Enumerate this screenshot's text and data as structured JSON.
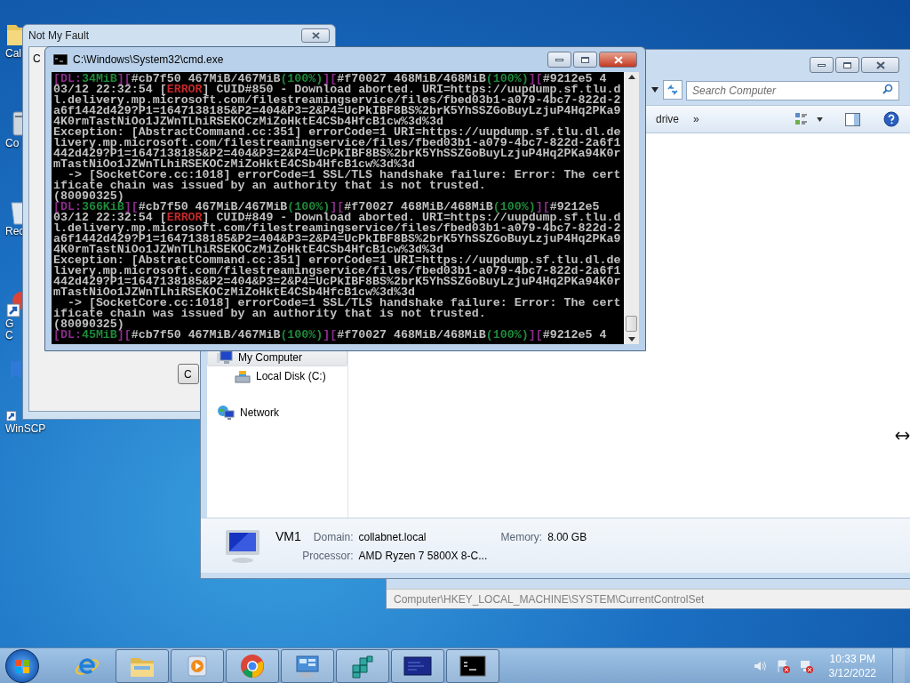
{
  "desktop_icons": [
    {
      "kind": "folder",
      "label_lines": [
        "Cal"
      ]
    },
    {
      "kind": "drive",
      "label_lines": [
        "Co"
      ]
    },
    {
      "kind": "recycle",
      "label_lines": [
        "Rec"
      ]
    },
    {
      "kind": "chrome-shortcut",
      "label_lines": [
        "G",
        "C"
      ]
    },
    {
      "kind": "bookmark"
    },
    {
      "kind": "winscp",
      "label_lines": [
        "WinSCP"
      ]
    }
  ],
  "back_window": {
    "title": "Not My Fault",
    "panel_text": "C",
    "button": "C"
  },
  "registry_window": {
    "status": "Computer\\HKEY_LOCAL_MACHINE\\SYSTEM\\CurrentControlSet"
  },
  "explorer": {
    "search": {
      "placeholder": "Search Computer"
    },
    "toolbar": {
      "command": "drive",
      "more": "»"
    },
    "nav": [
      {
        "label": "My Computer",
        "kind": "computer",
        "selected": true,
        "children": [
          {
            "label": "Local Disk (C:)",
            "kind": "disk",
            "selected": false
          }
        ]
      },
      {
        "label": "Network",
        "kind": "network",
        "selected": false
      }
    ],
    "details": {
      "name": "VM1",
      "domain_label": "Domain:",
      "domain": "collabnet.local",
      "memory_label": "Memory:",
      "memory": "8.00 GB",
      "processor_label": "Processor:",
      "processor": "AMD Ryzen 7 5800X 8-C..."
    }
  },
  "console": {
    "title": "C:\\Windows\\System32\\cmd.exe",
    "lines": [
      [
        {
          "text": "[DL:",
          "color": "#8b2c8b"
        },
        {
          "text": "34MiB",
          "color": "#1e8a3a"
        },
        {
          "text": "][",
          "color": "#8b2c8b"
        },
        {
          "text": "#cb7f50 467MiB/467MiB",
          "color": "#c0c0c0"
        },
        {
          "text": "(100%)",
          "color": "#1e8a3a"
        },
        {
          "text": "][",
          "color": "#8b2c8b"
        },
        {
          "text": "#f70027 468MiB/468MiB",
          "color": "#c0c0c0"
        },
        {
          "text": "(100%)",
          "color": "#1e8a3a"
        },
        {
          "text": "][",
          "color": "#8b2c8b"
        },
        {
          "text": "#9212e5 4",
          "color": "#c0c0c0"
        }
      ],
      [
        {
          "text": "03/12 22:32:54 [",
          "color": "#c0c0c0"
        },
        {
          "text": "ERROR",
          "color": "#c62828"
        },
        {
          "text": "] CUID#850 - Download aborted. URI=https://uupdump.sf.tlu.d",
          "color": "#c0c0c0"
        }
      ],
      [
        {
          "text": "l.delivery.mp.microsoft.com/filestreamingservice/files/fbed03b1-a079-4bc7-822d-2",
          "color": "#c0c0c0"
        }
      ],
      [
        {
          "text": "a6f1442d429?P1=1647138185&P2=404&P3=2&P4=UcPkIBF8BS%2brK5YhSSZGoBuyLzjuP4Hq2PKa9",
          "color": "#c0c0c0"
        }
      ],
      [
        {
          "text": "4K0rmTastNiOo1JZWnTLhiRSEKOCzMiZoHktE4CSb4HfcB1cw%3d%3d",
          "color": "#c0c0c0"
        }
      ],
      [
        {
          "text": "Exception: [AbstractCommand.cc:351] errorCode=1 URI=https://uupdump.sf.tlu.dl.de",
          "color": "#c0c0c0"
        }
      ],
      [
        {
          "text": "livery.mp.microsoft.com/filestreamingservice/files/fbed03b1-a079-4bc7-822d-2a6f1",
          "color": "#c0c0c0"
        }
      ],
      [
        {
          "text": "442d429?P1=1647138185&P2=404&P3=2&P4=UcPkIBF8BS%2brK5YhSSZGoBuyLzjuP4Hq2PKa94K0r",
          "color": "#c0c0c0"
        }
      ],
      [
        {
          "text": "mTastNiOo1JZWnTLhiRSEKOCzMiZoHktE4CSb4HfcB1cw%3d%3d",
          "color": "#c0c0c0"
        }
      ],
      [
        {
          "text": "  -> [SocketCore.cc:1018] errorCode=1 SSL/TLS handshake failure: Error: The cert",
          "color": "#c0c0c0"
        }
      ],
      [
        {
          "text": "ificate chain was issued by an authority that is not trusted.",
          "color": "#c0c0c0"
        }
      ],
      [
        {
          "text": "(80090325)",
          "color": "#c0c0c0"
        }
      ],
      [
        {
          "text": "[DL:",
          "color": "#8b2c8b"
        },
        {
          "text": "366KiB",
          "color": "#1e8a3a"
        },
        {
          "text": "][",
          "color": "#8b2c8b"
        },
        {
          "text": "#cb7f50 467MiB/467MiB",
          "color": "#c0c0c0"
        },
        {
          "text": "(100%)",
          "color": "#1e8a3a"
        },
        {
          "text": "][",
          "color": "#8b2c8b"
        },
        {
          "text": "#f70027 468MiB/468MiB",
          "color": "#c0c0c0"
        },
        {
          "text": "(100%)",
          "color": "#1e8a3a"
        },
        {
          "text": "][",
          "color": "#8b2c8b"
        },
        {
          "text": "#9212e5",
          "color": "#c0c0c0"
        }
      ],
      [
        {
          "text": "03/12 22:32:54 [",
          "color": "#c0c0c0"
        },
        {
          "text": "ERROR",
          "color": "#c62828"
        },
        {
          "text": "] CUID#849 - Download aborted. URI=https://uupdump.sf.tlu.d",
          "color": "#c0c0c0"
        }
      ],
      [
        {
          "text": "l.delivery.mp.microsoft.com/filestreamingservice/files/fbed03b1-a079-4bc7-822d-2",
          "color": "#c0c0c0"
        }
      ],
      [
        {
          "text": "a6f1442d429?P1=1647138185&P2=404&P3=2&P4=UcPkIBF8BS%2brK5YhSSZGoBuyLzjuP4Hq2PKa9",
          "color": "#c0c0c0"
        }
      ],
      [
        {
          "text": "4K0rmTastNiOo1JZWnTLhiRSEKOCzMiZoHktE4CSb4HfcB1cw%3d%3d",
          "color": "#c0c0c0"
        }
      ],
      [
        {
          "text": "Exception: [AbstractCommand.cc:351] errorCode=1 URI=https://uupdump.sf.tlu.dl.de",
          "color": "#c0c0c0"
        }
      ],
      [
        {
          "text": "livery.mp.microsoft.com/filestreamingservice/files/fbed03b1-a079-4bc7-822d-2a6f1",
          "color": "#c0c0c0"
        }
      ],
      [
        {
          "text": "442d429?P1=1647138185&P2=404&P3=2&P4=UcPkIBF8BS%2brK5YhSSZGoBuyLzjuP4Hq2PKa94K0r",
          "color": "#c0c0c0"
        }
      ],
      [
        {
          "text": "mTastNiOo1JZWnTLhiRSEKOCzMiZoHktE4CSb4HfcB1cw%3d%3d",
          "color": "#c0c0c0"
        }
      ],
      [
        {
          "text": "  -> [SocketCore.cc:1018] errorCode=1 SSL/TLS handshake failure: Error: The cert",
          "color": "#c0c0c0"
        }
      ],
      [
        {
          "text": "ificate chain was issued by an authority that is not trusted.",
          "color": "#c0c0c0"
        }
      ],
      [
        {
          "text": "(80090325)",
          "color": "#c0c0c0"
        }
      ],
      [
        {
          "text": "[DL:",
          "color": "#8b2c8b"
        },
        {
          "text": "45MiB",
          "color": "#1e8a3a"
        },
        {
          "text": "][",
          "color": "#8b2c8b"
        },
        {
          "text": "#cb7f50 467MiB/467MiB",
          "color": "#c0c0c0"
        },
        {
          "text": "(100%)",
          "color": "#1e8a3a"
        },
        {
          "text": "][",
          "color": "#8b2c8b"
        },
        {
          "text": "#f70027 468MiB/468MiB",
          "color": "#c0c0c0"
        },
        {
          "text": "(100%)",
          "color": "#1e8a3a"
        },
        {
          "text": "][",
          "color": "#8b2c8b"
        },
        {
          "text": "#9212e5 4",
          "color": "#c0c0c0"
        }
      ]
    ]
  },
  "taskbar": {
    "apps": [
      {
        "kind": "ie"
      },
      {
        "kind": "explorer"
      },
      {
        "kind": "media"
      },
      {
        "kind": "chrome"
      },
      {
        "kind": "control-panel"
      },
      {
        "kind": "registry"
      },
      {
        "kind": "blue-window"
      },
      {
        "kind": "console"
      }
    ],
    "tray": [
      {
        "kind": "volume"
      },
      {
        "kind": "flag"
      },
      {
        "kind": "network"
      }
    ],
    "time": "10:33 PM",
    "date": "3/12/2022"
  }
}
